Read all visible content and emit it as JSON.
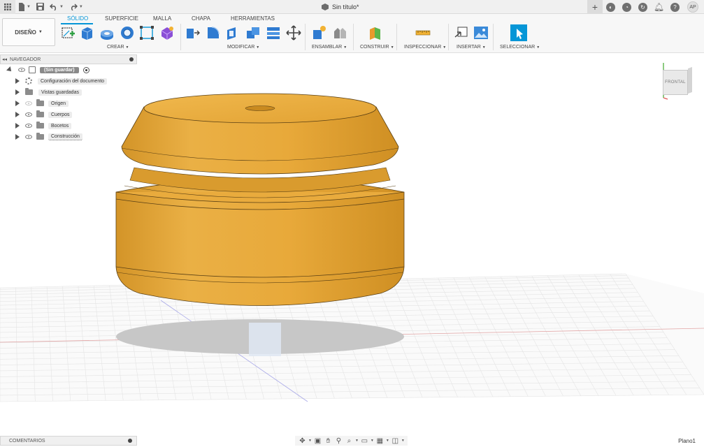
{
  "titlebar": {
    "doc_title": "Sin título*",
    "close_symbol": "×",
    "new_tab_symbol": "+",
    "user_initials": "AP",
    "help_symbol": "?",
    "icons": [
      "apps-grid-icon",
      "file-icon",
      "save-icon",
      "undo-icon",
      "redo-icon",
      "extensions-icon",
      "job-status-icon",
      "notifications-icon",
      "help-icon"
    ]
  },
  "ribbon": {
    "workspace_label": "DISEÑO",
    "tabs": [
      "SÓLIDO",
      "SUPERFICIE",
      "MALLA",
      "CHAPA",
      "HERRAMIENTAS"
    ],
    "active_tab": "SÓLIDO",
    "groups": [
      {
        "label": "CREAR"
      },
      {
        "label": "MODIFICAR"
      },
      {
        "label": "ENSAMBLAR"
      },
      {
        "label": "CONSTRUIR"
      },
      {
        "label": "INSPECCIONAR"
      },
      {
        "label": "INSERTAR"
      },
      {
        "label": "SELECCIONAR"
      }
    ],
    "accent_color": "#0696d7"
  },
  "navigator": {
    "title": "NAVEGADOR",
    "root_label": "(Sin guardar)",
    "items": [
      {
        "label": "Configuración del documento",
        "icon": "gear-icon"
      },
      {
        "label": "Vistas guardadas",
        "icon": "folder-icon"
      },
      {
        "label": "Origen",
        "icon": "folder-icon"
      },
      {
        "label": "Cuerpos",
        "icon": "folder-icon"
      },
      {
        "label": "Bocetos",
        "icon": "folder-icon"
      },
      {
        "label": "Construcción",
        "icon": "folder-icon"
      }
    ]
  },
  "viewcube": {
    "face_label": "FRONTAL"
  },
  "model": {
    "body_color": "#e8a93a"
  },
  "bottombar": {
    "comments_label": "COMENTARIOS",
    "plane_label": "Plano1"
  }
}
